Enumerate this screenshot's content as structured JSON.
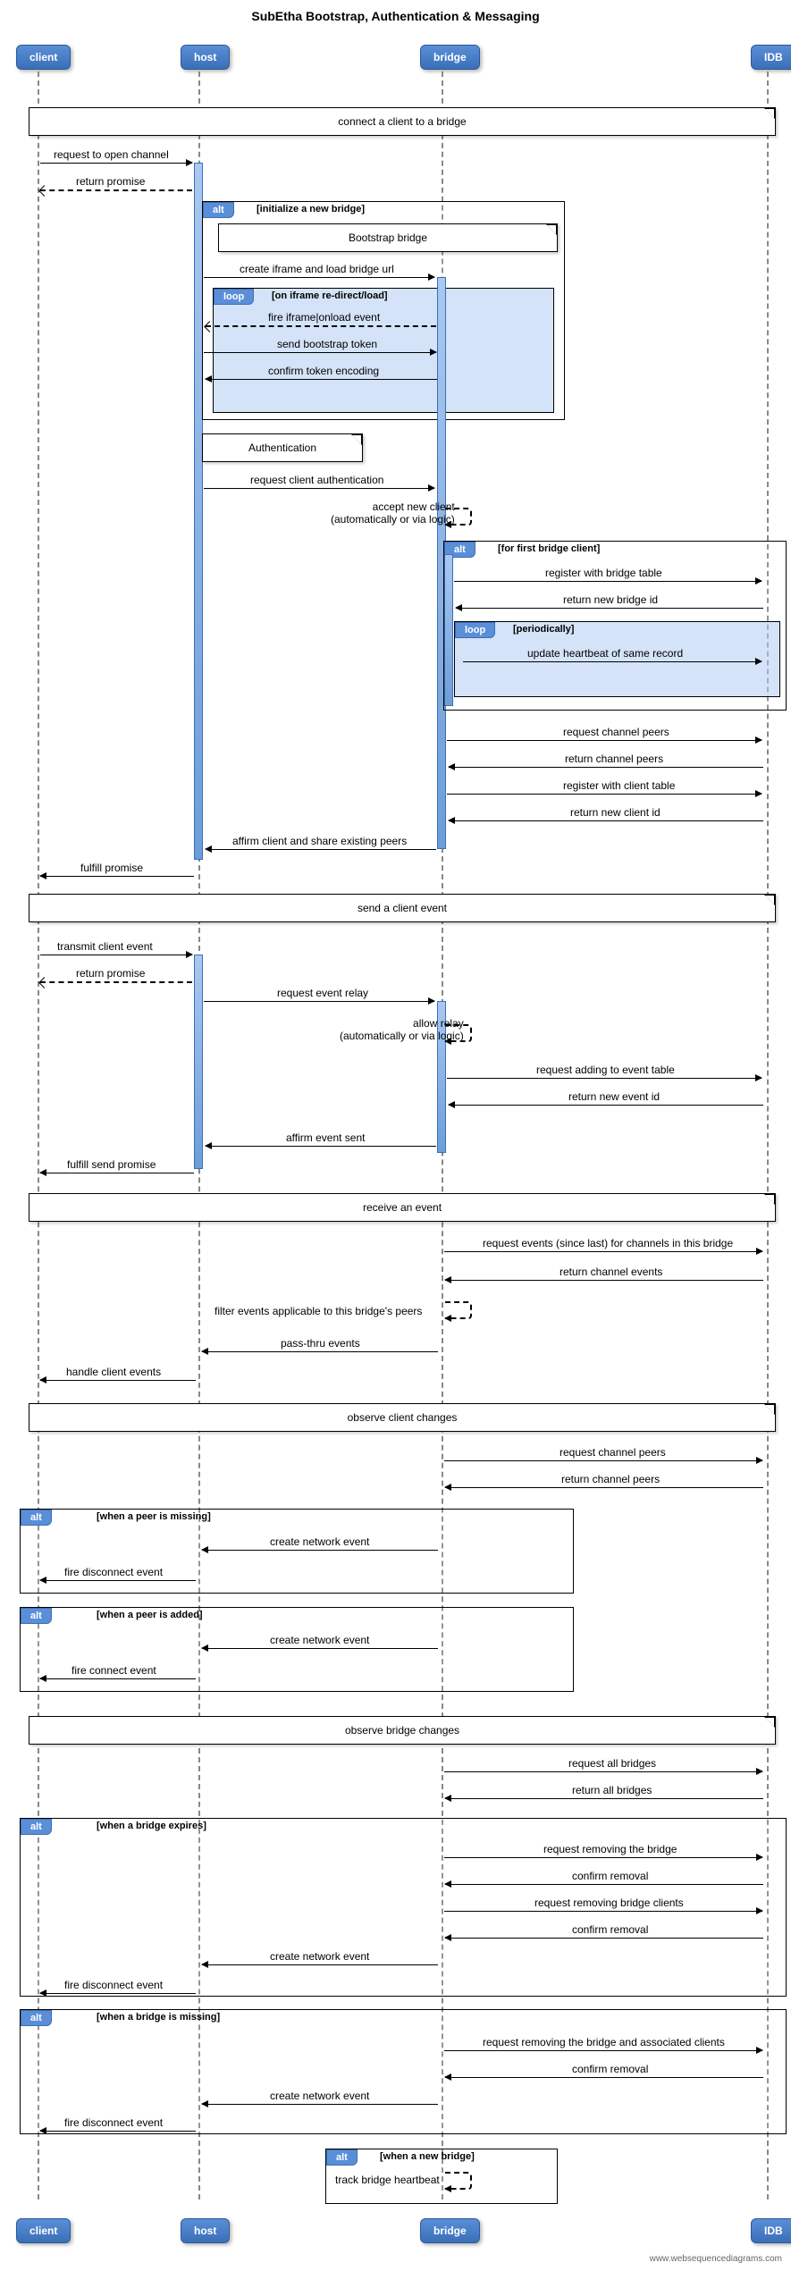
{
  "title": "SubEtha Bootstrap, Authentication & Messaging",
  "actors": {
    "client": "client",
    "host": "host",
    "bridge": "bridge",
    "idb": "IDB"
  },
  "notes": {
    "connect": "connect a client to a bridge",
    "bootstrap": "Bootstrap bridge",
    "auth": "Authentication",
    "send": "send a client event",
    "receive": "receive an event",
    "obs_client": "observe client changes",
    "obs_bridge": "observe bridge changes"
  },
  "frames": {
    "alt": "alt",
    "loop": "loop",
    "init_bridge": "[initialize a new bridge]",
    "iframe": "[on iframe re-direct/load]",
    "first_client": "[for first bridge client]",
    "periodically": "[periodically]",
    "peer_missing": "[when a peer is missing]",
    "peer_added": "[when a peer is added]",
    "bridge_expires": "[when a bridge expires]",
    "bridge_missing": "[when a bridge is missing]",
    "new_bridge": "[when a new bridge]"
  },
  "messages": {
    "req_open": "request to open channel",
    "ret_promise": "return promise",
    "create_iframe": "create iframe and load bridge url",
    "fire_iframe": "fire iframe|onload event",
    "send_token": "send bootstrap token",
    "confirm_token": "confirm token encoding",
    "req_auth": "request client authentication",
    "accept_new": "accept new client\n(automatically or via logic)",
    "reg_bridge_table": "register with bridge table",
    "ret_new_bridge": "return new bridge id",
    "update_heartbeat": "update heartbeat of same record",
    "req_channel_peers": "request channel peers",
    "ret_channel_peers": "return channel peers",
    "reg_client_table": "register with client table",
    "ret_new_client": "return new client id",
    "affirm_client": "affirm client and share existing peers",
    "fulfill_promise": "fulfill promise",
    "transmit_event": "transmit client event",
    "req_relay": "request event relay",
    "allow_relay": "allow relay\n(automatically or via logic)",
    "req_add_event": "request adding to event table",
    "ret_event_id": "return new event id",
    "affirm_sent": "affirm event sent",
    "fulfill_send": "fulfill send promise",
    "req_events": "request events (since last) for channels in this bridge",
    "ret_events": "return channel events",
    "filter_events": "filter events applicable to this bridge's peers",
    "pass_thru": "pass-thru events",
    "handle_events": "handle client events",
    "create_net": "create network event",
    "fire_disconnect": "fire disconnect event",
    "fire_connect": "fire connect event",
    "req_all_bridges": "request all bridges",
    "ret_all_bridges": "return all bridges",
    "req_remove_bridge": "request removing the bridge",
    "confirm_removal": "confirm removal",
    "req_remove_clients": "request removing bridge clients",
    "req_remove_assoc": "request removing the bridge and associated clients",
    "track_heartbeat": "track bridge heartbeat"
  },
  "footer": "www.websequencediagrams.com"
}
